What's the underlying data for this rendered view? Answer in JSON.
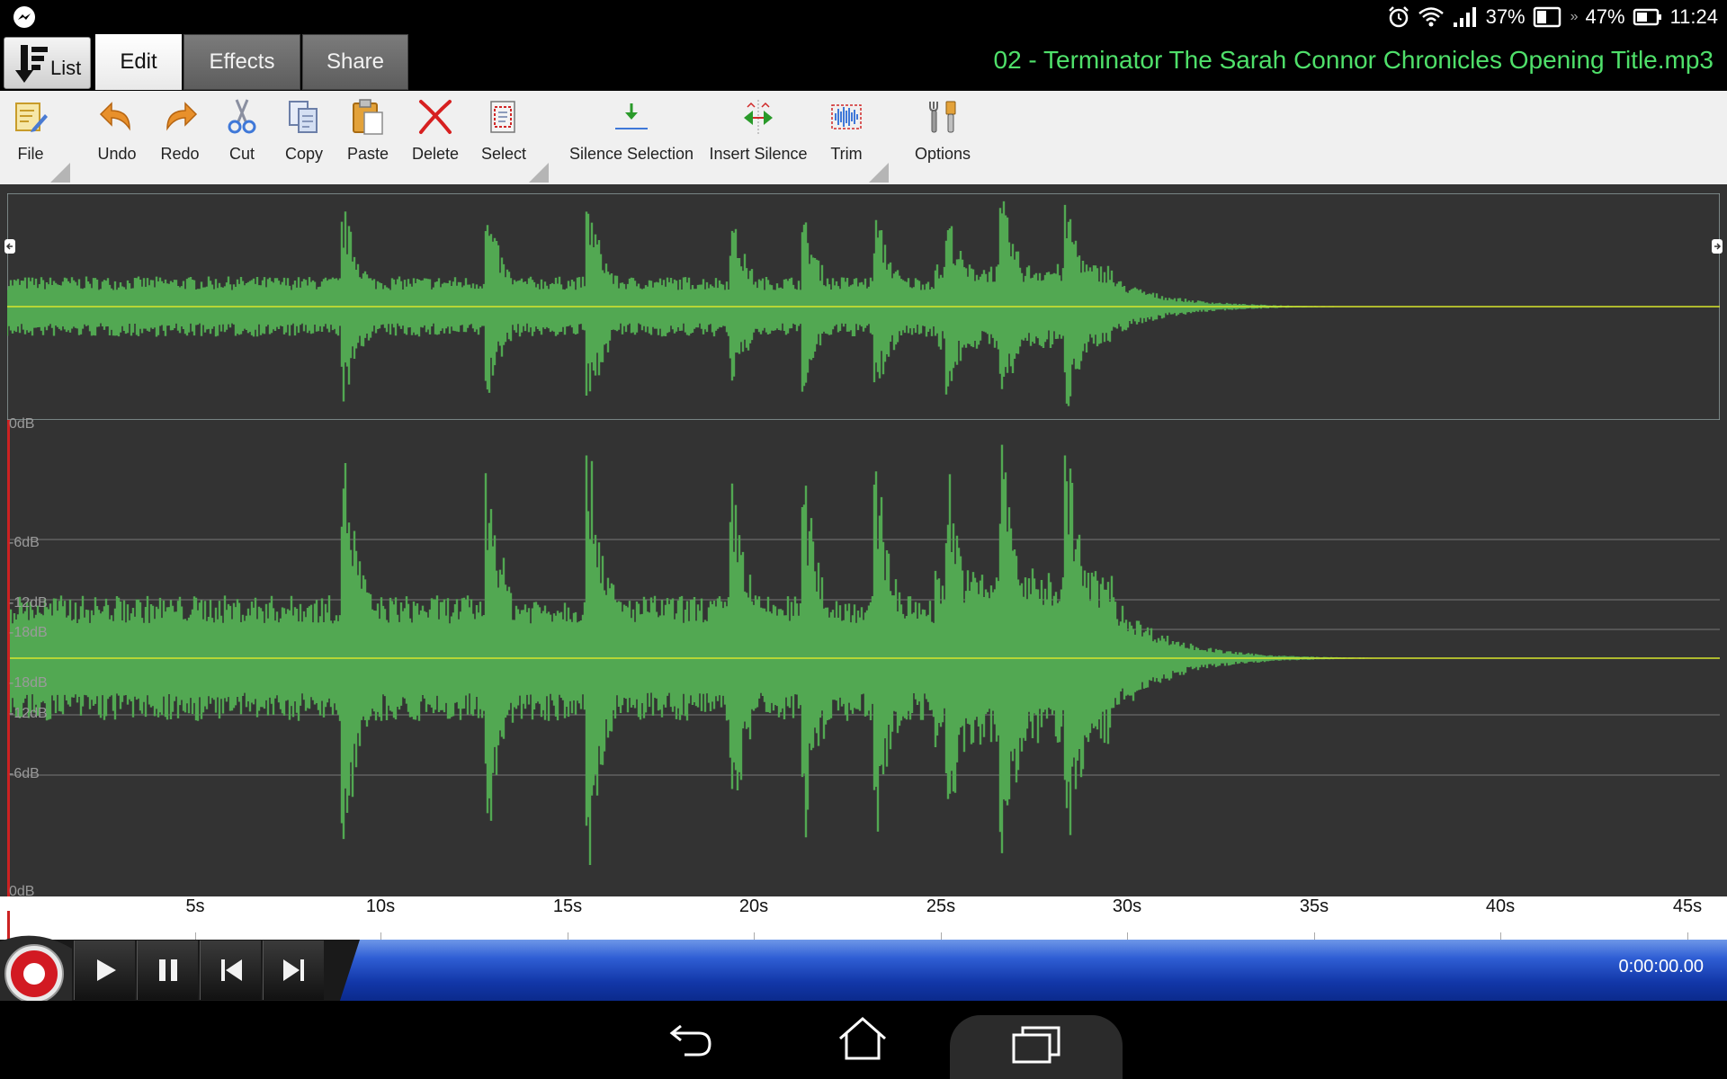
{
  "status_bar": {
    "wifi_percent": "37%",
    "battery_percent": "47%",
    "time": "11:24"
  },
  "tabs": {
    "list_label": "List",
    "items": [
      {
        "label": "Edit",
        "active": true
      },
      {
        "label": "Effects",
        "active": false
      },
      {
        "label": "Share",
        "active": false
      }
    ]
  },
  "file_title": "02 - Terminator The Sarah Connor Chronicles Opening Title.mp3",
  "toolbar": {
    "file": "File",
    "undo": "Undo",
    "redo": "Redo",
    "cut": "Cut",
    "copy": "Copy",
    "paste": "Paste",
    "delete": "Delete",
    "select": "Select",
    "silence_selection": "Silence Selection",
    "insert_silence": "Insert Silence",
    "trim": "Trim",
    "options": "Options"
  },
  "waveform": {
    "color": "#52a852",
    "background": "#333333",
    "center_line_color": "#d8e62c",
    "db_labels": [
      "0dB",
      "-6dB",
      "-12dB",
      "-18dB",
      "-18dB",
      "-12dB",
      "-6dB",
      "0dB"
    ],
    "duration_seconds": 46
  },
  "time_ruler": {
    "labels": [
      "5s",
      "10s",
      "15s",
      "20s",
      "25s",
      "30s",
      "35s",
      "40s",
      "45s"
    ]
  },
  "transport": {
    "time_display": "0:00:00.00",
    "progress": 0
  }
}
